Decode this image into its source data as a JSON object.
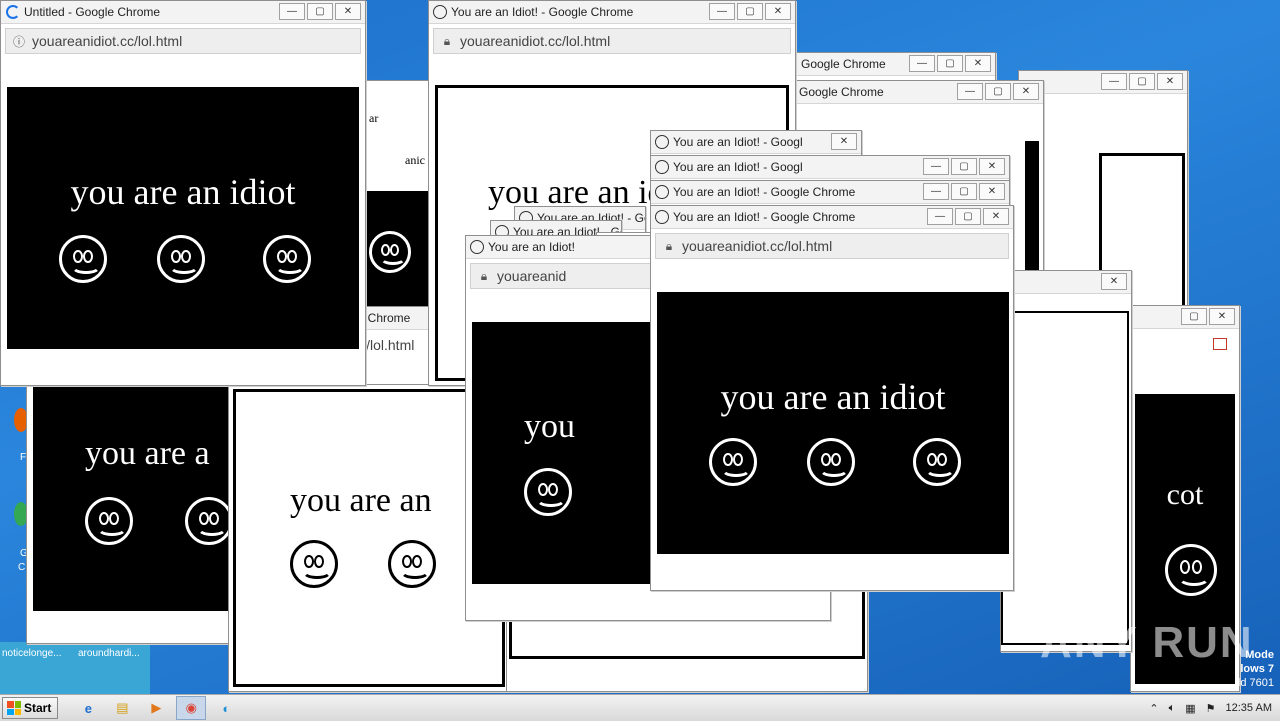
{
  "windows": {
    "untitled_title": "Untitled - Google Chrome",
    "idiot_title": "You are an Idiot! - Google Chrome",
    "idiot_title_cut": "You are an Idiot! - Googl",
    "idiot_title_short": "You are an Idiot!",
    "chrome_fragment": "Google Chrome",
    "chrome_fragment2": "kle Chrome",
    "url_info": "youareanidiot.cc/lol.html",
    "url_lock": "youareanidiot.cc/lol.html",
    "url_partial": "youareanid",
    "url_fragment": "i/lol.html"
  },
  "page": {
    "message": "you are an idiot",
    "message_cut1": "you are an",
    "message_cut2": "you are a",
    "message_cut3": "you",
    "message_cut4": "cot",
    "message_cut5": "iot",
    "frag_id": "id",
    "frag_ar": "ar",
    "frag_ani": "anic"
  },
  "controls": {
    "minimize": "—",
    "maximize": "▢",
    "close": "✕"
  },
  "taskbar": {
    "start_label": "Start",
    "clock": "12:35 AM",
    "apps": [
      "ie-icon",
      "explorer-icon",
      "media-icon",
      "chrome-icon",
      "edge-icon"
    ]
  },
  "desktop": {
    "icon1_label": "F",
    "icon2_label": "G",
    "icon2_label2": "C",
    "notice1": "noticelonge...",
    "notice2": "aroundhardi...",
    "mode_line1": "Mode",
    "mode_line2": "lows 7",
    "mode_line3": "ld 7601",
    "watermark": "ANY RUN"
  },
  "colors": {
    "desktop": "#2a86dc",
    "accent": "#1a73e8"
  }
}
